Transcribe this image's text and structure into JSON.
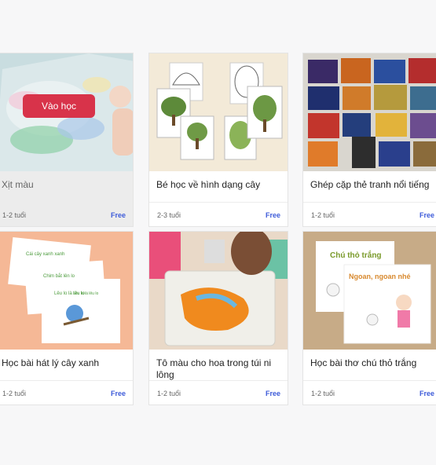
{
  "cards": [
    {
      "title": "Xịt màu",
      "age": "1-2 tuổi",
      "price": "Free",
      "button": "Vào học"
    },
    {
      "title": "Bé học về hình dạng cây",
      "age": "2-3 tuổi",
      "price": "Free"
    },
    {
      "title": "Ghép cặp thẻ tranh nổi tiếng",
      "age": "1-2 tuổi",
      "price": "Free"
    },
    {
      "title": "Học bài hát lý cây xanh",
      "age": "1-2 tuổi",
      "price": "Free",
      "thumb_text": [
        "Cái cây xanh xanh",
        "Chim bắt lên lo",
        "Lêu lo là lêu lo",
        "Lêu lo là lêu lo"
      ]
    },
    {
      "title": "Tô màu cho hoa trong túi ni lông",
      "age": "1-2 tuổi",
      "price": "Free"
    },
    {
      "title": "Học bài thơ chú thỏ trắng",
      "age": "1-2 tuổi",
      "price": "Free",
      "thumb_text": [
        "Chú thỏ trắng",
        "Ngoan, ngoan nhé"
      ]
    }
  ],
  "colors": {
    "accent_red": "#d8334a",
    "free_blue": "#3d5bd9"
  }
}
